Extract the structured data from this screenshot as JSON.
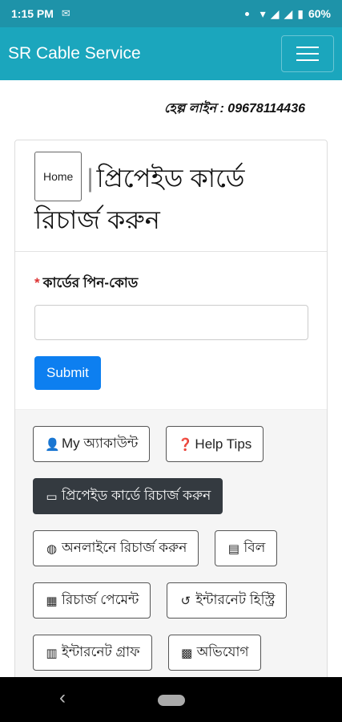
{
  "statusbar": {
    "time": "1:15 PM",
    "battery": "60%"
  },
  "appbar": {
    "brand": "SR Cable Service"
  },
  "helpline": "হেল্প লাইন : 09678114436",
  "card": {
    "home_label": "Home",
    "separator": "|",
    "title": "প্রিপেইড কার্ডে রিচার্জ করুন",
    "pin_label": "কার্ডের পিন-কোড",
    "required_mark": "*",
    "pin_value": "",
    "submit_label": "Submit"
  },
  "buttons": {
    "my_account": "My অ্যাকাউন্ট",
    "help_tips": "Help Tips",
    "prepaid_recharge": "প্রিপেইড কার্ডে রিচার্জ করুন",
    "online_recharge": "অনলাইনে রিচার্জ করুন",
    "bill": "বিল",
    "recharge_payment": "রিচার্জ পেমেন্ট",
    "internet_history": "ইন্টারনেট হিস্ট্রি",
    "internet_graph": "ইন্টারনেট গ্রাফ",
    "complaint": "অভিযোগ"
  },
  "icons": {
    "user": "user-icon",
    "help": "question-circle-icon",
    "card": "credit-card-icon",
    "globe": "globe-icon",
    "bill": "file-invoice-icon",
    "store": "store-icon",
    "history": "history-icon",
    "chart": "bar-chart-icon",
    "complaint": "money-complaint-icon"
  },
  "colors": {
    "appbar": "#1ba6bd",
    "statusbar": "#1e93a9",
    "submit": "#0d7ff0",
    "active_button": "#343a40"
  }
}
